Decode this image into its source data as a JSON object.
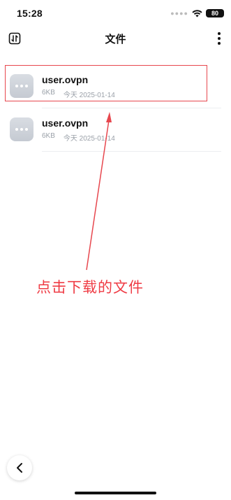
{
  "status_bar": {
    "time": "15:28",
    "battery": "80"
  },
  "nav": {
    "title": "文件"
  },
  "files": [
    {
      "name": "user.ovpn",
      "size": "6KB",
      "date": "今天 2025-01-14"
    },
    {
      "name": "user.ovpn",
      "size": "6KB",
      "date": "今天 2025-01-14"
    }
  ],
  "annotation": {
    "text": "点击下载的文件",
    "color": "#ef3b44"
  },
  "icons": {
    "nav_left": "sort-icon",
    "nav_right": "more-vertical-icon",
    "file": "file-more-icon",
    "back": "chevron-left-icon"
  }
}
